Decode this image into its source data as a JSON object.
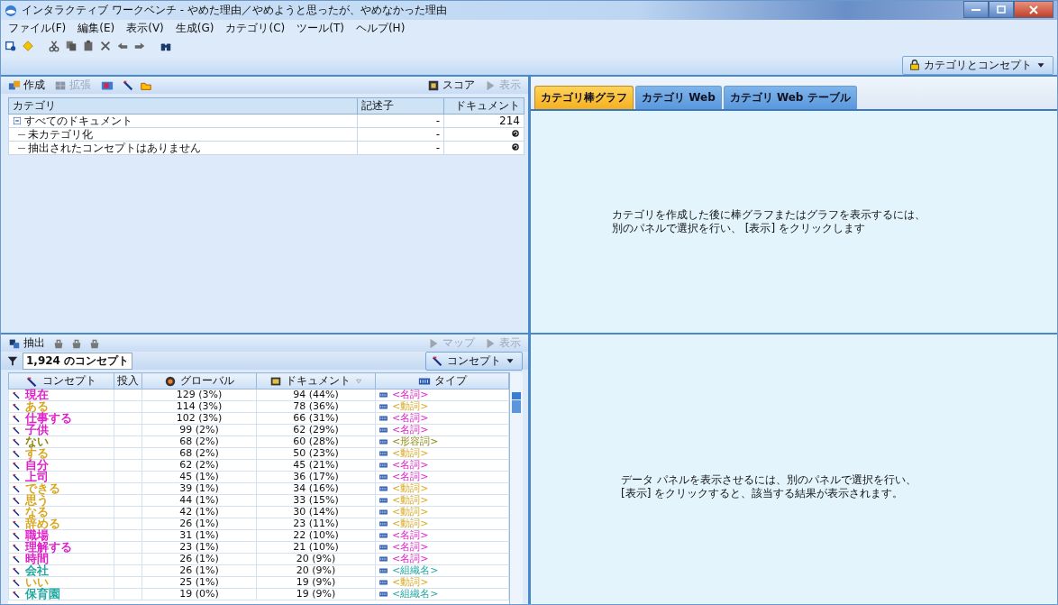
{
  "window": {
    "title": "インタラクティブ ワークベンチ - やめた理由／やめようと思ったが、やめなかった理由"
  },
  "menu": [
    "ファイル(F)",
    "編集(E)",
    "表示(V)",
    "生成(G)",
    "カテゴリ(C)",
    "ツール(T)",
    "ヘルプ(H)"
  ],
  "view_selector": {
    "label": "カテゴリとコンセプト"
  },
  "categories_panel": {
    "toolbar": {
      "left": [
        {
          "label": "作成",
          "disabled": false
        },
        {
          "label": "拡張",
          "disabled": true
        }
      ],
      "right": [
        {
          "label": "スコア",
          "disabled": false
        },
        {
          "label": "表示",
          "disabled": true
        }
      ]
    },
    "table": {
      "columns": [
        "カテゴリ",
        "記述子",
        "ドキュメント"
      ],
      "rows": [
        {
          "category": "すべてのドキュメント",
          "descriptor": "-",
          "documents": "214",
          "expanded": true,
          "children": [
            {
              "category": "未カテゴリ化",
              "descriptor": "-"
            },
            {
              "category": "抽出されたコンセプトはありません",
              "descriptor": "-"
            }
          ]
        }
      ]
    }
  },
  "visual_panel": {
    "tabs": [
      {
        "label": "カテゴリ棒グラフ",
        "selected": true
      },
      {
        "label": "カテゴリ Web",
        "selected": false
      },
      {
        "label": "カテゴリ Web テーブル",
        "selected": false
      }
    ],
    "message": [
      "カテゴリを作成した後に棒グラフまたはグラフを表示するには、",
      "別のパネルで選択を行い、 [表示] をクリックします"
    ]
  },
  "extraction_panel": {
    "toolbar": {
      "left": {
        "label": "抽出"
      },
      "right": [
        {
          "label": "マップ",
          "disabled": true
        },
        {
          "label": "表示",
          "disabled": true
        }
      ]
    },
    "filter": {
      "value": "1,924 のコンセプト"
    },
    "dropdown": {
      "label": "コンセプト"
    },
    "table": {
      "columns": [
        "コンセプト",
        "投入",
        "グローバル",
        "ドキュメント",
        "タイプ"
      ],
      "rows": [
        {
          "concept": "現在",
          "global": "129 (3%)",
          "documents": "94 (44%)",
          "type": "<名詞>",
          "color": "#e020c8"
        },
        {
          "concept": "ある",
          "global": "114 (3%)",
          "documents": "78 (36%)",
          "type": "<動詞>",
          "color": "#d8a820"
        },
        {
          "concept": "仕事する",
          "global": "102 (3%)",
          "documents": "66 (31%)",
          "type": "<名詞>",
          "color": "#e020c8"
        },
        {
          "concept": "子供",
          "global": "99 (2%)",
          "documents": "62 (29%)",
          "type": "<名詞>",
          "color": "#e020c8"
        },
        {
          "concept": "ない",
          "global": "68 (2%)",
          "documents": "60 (28%)",
          "type": "<形容詞>",
          "color": "#8a8a10"
        },
        {
          "concept": "する",
          "global": "68 (2%)",
          "documents": "50 (23%)",
          "type": "<動詞>",
          "color": "#d8a820"
        },
        {
          "concept": "自分",
          "global": "62 (2%)",
          "documents": "45 (21%)",
          "type": "<名詞>",
          "color": "#e020c8"
        },
        {
          "concept": "上司",
          "global": "45 (1%)",
          "documents": "36 (17%)",
          "type": "<名詞>",
          "color": "#e020c8"
        },
        {
          "concept": "できる",
          "global": "39 (1%)",
          "documents": "34 (16%)",
          "type": "<動詞>",
          "color": "#d8a820"
        },
        {
          "concept": "思う",
          "global": "44 (1%)",
          "documents": "33 (15%)",
          "type": "<動詞>",
          "color": "#d8a820"
        },
        {
          "concept": "なる",
          "global": "42 (1%)",
          "documents": "30 (14%)",
          "type": "<動詞>",
          "color": "#d8a820"
        },
        {
          "concept": "辞める",
          "global": "26 (1%)",
          "documents": "23 (11%)",
          "type": "<動詞>",
          "color": "#d8a820"
        },
        {
          "concept": "職場",
          "global": "31 (1%)",
          "documents": "22 (10%)",
          "type": "<名詞>",
          "color": "#e020c8"
        },
        {
          "concept": "理解する",
          "global": "23 (1%)",
          "documents": "21 (10%)",
          "type": "<名詞>",
          "color": "#e020c8"
        },
        {
          "concept": "時間",
          "global": "26 (1%)",
          "documents": "20 (9%)",
          "type": "<名詞>",
          "color": "#e020c8"
        },
        {
          "concept": "会社",
          "global": "26 (1%)",
          "documents": "20 (9%)",
          "type": "<組織名>",
          "color": "#20a8a0"
        },
        {
          "concept": "いい",
          "global": "25 (1%)",
          "documents": "19 (9%)",
          "type": "<動詞>",
          "color": "#d8a820"
        },
        {
          "concept": "保育園",
          "global": "19 (0%)",
          "documents": "19 (9%)",
          "type": "<組織名>",
          "color": "#20a8a0"
        }
      ]
    }
  },
  "data_panel": {
    "message": [
      "データ パネルを表示させるには、別のパネルで選択を行い、",
      "[表示] をクリックすると、該当する結果が表示されます。"
    ]
  }
}
